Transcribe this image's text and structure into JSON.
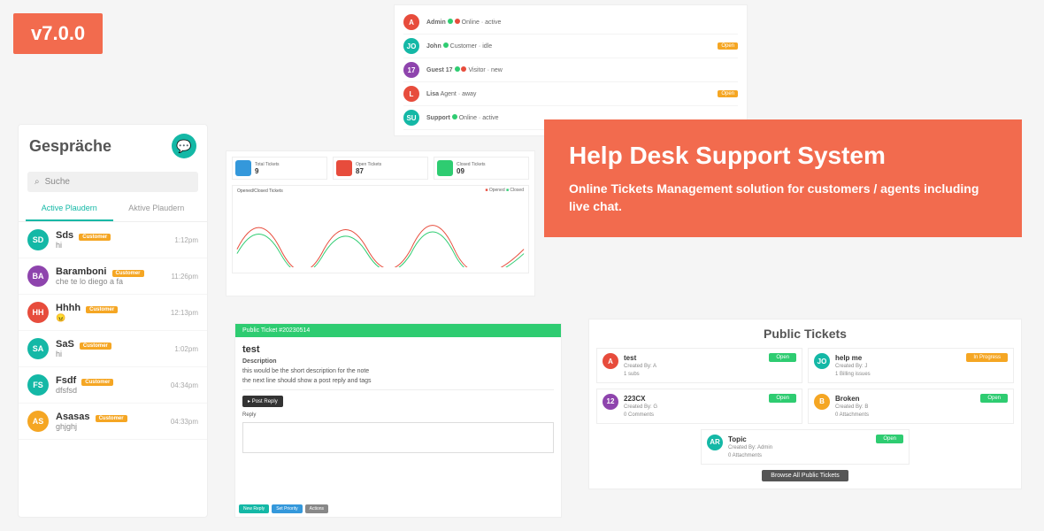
{
  "version": "v7.0.0",
  "hero": {
    "title": "Help Desk Support System",
    "subtitle": "Online Tickets Management solution for customers / agents including live chat."
  },
  "topList": [
    {
      "av": "A",
      "color": "#e74c3c",
      "name": "Admin",
      "meta": "Online · active",
      "badge": ""
    },
    {
      "av": "JO",
      "color": "#14b8a6",
      "name": "John",
      "meta": "Customer · idle",
      "badge": "Open"
    },
    {
      "av": "17",
      "color": "#8e44ad",
      "name": "Guest 17",
      "meta": "Visitor · new",
      "badge": ""
    },
    {
      "av": "L",
      "color": "#e74c3c",
      "name": "Lisa",
      "meta": "Agent · away",
      "badge": "Open"
    },
    {
      "av": "SU",
      "color": "#14b8a6",
      "name": "Support",
      "meta": "Online · active",
      "badge": ""
    }
  ],
  "chat": {
    "title": "Gespräche",
    "search": "Suche",
    "tabs": {
      "active": "Active Plaudern",
      "inactive": "Aktive Plaudern"
    },
    "items": [
      {
        "av": "SD",
        "color": "#14b8a6",
        "name": "Sds",
        "pill": "Customer",
        "msg": "hi",
        "time": "1:12pm"
      },
      {
        "av": "BA",
        "color": "#8e44ad",
        "name": "Baramboni",
        "pill": "Customer",
        "msg": "che te lo diego a fa",
        "time": "11:26pm"
      },
      {
        "av": "HH",
        "color": "#e74c3c",
        "name": "Hhhh",
        "pill": "Customer",
        "msg": "😠",
        "time": "12:13pm"
      },
      {
        "av": "SA",
        "color": "#14b8a6",
        "name": "SaS",
        "pill": "Customer",
        "msg": "hi",
        "time": "1:02pm"
      },
      {
        "av": "FS",
        "color": "#14b8a6",
        "name": "Fsdf",
        "pill": "Customer",
        "msg": "dfsfsd",
        "time": "04:34pm"
      },
      {
        "av": "AS",
        "color": "#f5a623",
        "name": "Asasas",
        "pill": "Customer",
        "msg": "ghjghj",
        "time": "04:33pm"
      }
    ]
  },
  "dash": {
    "cards": [
      {
        "color": "#3498db",
        "label": "Total Tickets",
        "num": "9"
      },
      {
        "color": "#e74c3c",
        "label": "Open Tickets",
        "num": "87"
      },
      {
        "color": "#2ecc71",
        "label": "Closed Tickets",
        "num": "09"
      }
    ],
    "graphTitle": "Opened/Closed Tickets",
    "legend": [
      "Opened",
      "Closed"
    ]
  },
  "ticketDetail": {
    "bar": "Public Ticket #20230514",
    "title": "test",
    "descLabel": "Description",
    "desc": "this would be the short description for the note",
    "line": "the next line should show a post reply and tags",
    "post": "Post Reply",
    "replyLabel": "Reply",
    "btns": [
      "New Reply",
      "Set Priority",
      "Actions"
    ]
  },
  "pub": {
    "title": "Public Tickets",
    "items": [
      {
        "av": "A",
        "color": "#e74c3c",
        "t": "test",
        "by": "Created By: A",
        "sub": "1 subs",
        "btn": "Open",
        "btnColor": "#2ecc71"
      },
      {
        "av": "JO",
        "color": "#14b8a6",
        "t": "help me",
        "by": "Created By: J",
        "sub": "1 Billing issues",
        "btn": "In Progress",
        "btnColor": "#f5a623"
      },
      {
        "av": "12",
        "color": "#8e44ad",
        "t": "223CX",
        "by": "Created By: G",
        "sub": "0 Comments",
        "btn": "Open",
        "btnColor": "#2ecc71"
      },
      {
        "av": "B",
        "color": "#f5a623",
        "t": "Broken",
        "by": "Created By: B",
        "sub": "0 Attachments",
        "btn": "Open",
        "btnColor": "#2ecc71"
      },
      {
        "av": "AR",
        "color": "#14b8a6",
        "t": "Topic",
        "by": "Created By: Admin",
        "sub": "0 Attachments",
        "btn": "Open",
        "btnColor": "#2ecc71"
      }
    ],
    "browse": "Browse All Public Tickets"
  }
}
